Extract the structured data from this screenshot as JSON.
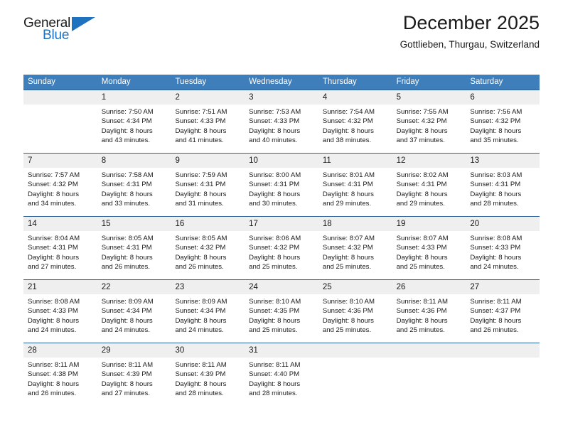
{
  "brand": {
    "name_part1": "General",
    "name_part2": "Blue",
    "flag_icon": "triangle-flag-icon"
  },
  "header": {
    "title": "December 2025",
    "subtitle": "Gottlieben, Thurgau, Switzerland"
  },
  "colors": {
    "header_blue": "#3d7ebb",
    "separator_blue": "#2b6198",
    "brand_blue": "#1f72bd",
    "day_band_gray": "#efefef",
    "text": "#1a1a1a"
  },
  "weekdays": [
    "Sunday",
    "Monday",
    "Tuesday",
    "Wednesday",
    "Thursday",
    "Friday",
    "Saturday"
  ],
  "weeks": [
    [
      {
        "day": "",
        "lines": []
      },
      {
        "day": "1",
        "lines": [
          "Sunrise: 7:50 AM",
          "Sunset: 4:34 PM",
          "Daylight: 8 hours",
          "and 43 minutes."
        ]
      },
      {
        "day": "2",
        "lines": [
          "Sunrise: 7:51 AM",
          "Sunset: 4:33 PM",
          "Daylight: 8 hours",
          "and 41 minutes."
        ]
      },
      {
        "day": "3",
        "lines": [
          "Sunrise: 7:53 AM",
          "Sunset: 4:33 PM",
          "Daylight: 8 hours",
          "and 40 minutes."
        ]
      },
      {
        "day": "4",
        "lines": [
          "Sunrise: 7:54 AM",
          "Sunset: 4:32 PM",
          "Daylight: 8 hours",
          "and 38 minutes."
        ]
      },
      {
        "day": "5",
        "lines": [
          "Sunrise: 7:55 AM",
          "Sunset: 4:32 PM",
          "Daylight: 8 hours",
          "and 37 minutes."
        ]
      },
      {
        "day": "6",
        "lines": [
          "Sunrise: 7:56 AM",
          "Sunset: 4:32 PM",
          "Daylight: 8 hours",
          "and 35 minutes."
        ]
      }
    ],
    [
      {
        "day": "7",
        "lines": [
          "Sunrise: 7:57 AM",
          "Sunset: 4:32 PM",
          "Daylight: 8 hours",
          "and 34 minutes."
        ]
      },
      {
        "day": "8",
        "lines": [
          "Sunrise: 7:58 AM",
          "Sunset: 4:31 PM",
          "Daylight: 8 hours",
          "and 33 minutes."
        ]
      },
      {
        "day": "9",
        "lines": [
          "Sunrise: 7:59 AM",
          "Sunset: 4:31 PM",
          "Daylight: 8 hours",
          "and 31 minutes."
        ]
      },
      {
        "day": "10",
        "lines": [
          "Sunrise: 8:00 AM",
          "Sunset: 4:31 PM",
          "Daylight: 8 hours",
          "and 30 minutes."
        ]
      },
      {
        "day": "11",
        "lines": [
          "Sunrise: 8:01 AM",
          "Sunset: 4:31 PM",
          "Daylight: 8 hours",
          "and 29 minutes."
        ]
      },
      {
        "day": "12",
        "lines": [
          "Sunrise: 8:02 AM",
          "Sunset: 4:31 PM",
          "Daylight: 8 hours",
          "and 29 minutes."
        ]
      },
      {
        "day": "13",
        "lines": [
          "Sunrise: 8:03 AM",
          "Sunset: 4:31 PM",
          "Daylight: 8 hours",
          "and 28 minutes."
        ]
      }
    ],
    [
      {
        "day": "14",
        "lines": [
          "Sunrise: 8:04 AM",
          "Sunset: 4:31 PM",
          "Daylight: 8 hours",
          "and 27 minutes."
        ]
      },
      {
        "day": "15",
        "lines": [
          "Sunrise: 8:05 AM",
          "Sunset: 4:31 PM",
          "Daylight: 8 hours",
          "and 26 minutes."
        ]
      },
      {
        "day": "16",
        "lines": [
          "Sunrise: 8:05 AM",
          "Sunset: 4:32 PM",
          "Daylight: 8 hours",
          "and 26 minutes."
        ]
      },
      {
        "day": "17",
        "lines": [
          "Sunrise: 8:06 AM",
          "Sunset: 4:32 PM",
          "Daylight: 8 hours",
          "and 25 minutes."
        ]
      },
      {
        "day": "18",
        "lines": [
          "Sunrise: 8:07 AM",
          "Sunset: 4:32 PM",
          "Daylight: 8 hours",
          "and 25 minutes."
        ]
      },
      {
        "day": "19",
        "lines": [
          "Sunrise: 8:07 AM",
          "Sunset: 4:33 PM",
          "Daylight: 8 hours",
          "and 25 minutes."
        ]
      },
      {
        "day": "20",
        "lines": [
          "Sunrise: 8:08 AM",
          "Sunset: 4:33 PM",
          "Daylight: 8 hours",
          "and 24 minutes."
        ]
      }
    ],
    [
      {
        "day": "21",
        "lines": [
          "Sunrise: 8:08 AM",
          "Sunset: 4:33 PM",
          "Daylight: 8 hours",
          "and 24 minutes."
        ]
      },
      {
        "day": "22",
        "lines": [
          "Sunrise: 8:09 AM",
          "Sunset: 4:34 PM",
          "Daylight: 8 hours",
          "and 24 minutes."
        ]
      },
      {
        "day": "23",
        "lines": [
          "Sunrise: 8:09 AM",
          "Sunset: 4:34 PM",
          "Daylight: 8 hours",
          "and 24 minutes."
        ]
      },
      {
        "day": "24",
        "lines": [
          "Sunrise: 8:10 AM",
          "Sunset: 4:35 PM",
          "Daylight: 8 hours",
          "and 25 minutes."
        ]
      },
      {
        "day": "25",
        "lines": [
          "Sunrise: 8:10 AM",
          "Sunset: 4:36 PM",
          "Daylight: 8 hours",
          "and 25 minutes."
        ]
      },
      {
        "day": "26",
        "lines": [
          "Sunrise: 8:11 AM",
          "Sunset: 4:36 PM",
          "Daylight: 8 hours",
          "and 25 minutes."
        ]
      },
      {
        "day": "27",
        "lines": [
          "Sunrise: 8:11 AM",
          "Sunset: 4:37 PM",
          "Daylight: 8 hours",
          "and 26 minutes."
        ]
      }
    ],
    [
      {
        "day": "28",
        "lines": [
          "Sunrise: 8:11 AM",
          "Sunset: 4:38 PM",
          "Daylight: 8 hours",
          "and 26 minutes."
        ]
      },
      {
        "day": "29",
        "lines": [
          "Sunrise: 8:11 AM",
          "Sunset: 4:39 PM",
          "Daylight: 8 hours",
          "and 27 minutes."
        ]
      },
      {
        "day": "30",
        "lines": [
          "Sunrise: 8:11 AM",
          "Sunset: 4:39 PM",
          "Daylight: 8 hours",
          "and 28 minutes."
        ]
      },
      {
        "day": "31",
        "lines": [
          "Sunrise: 8:11 AM",
          "Sunset: 4:40 PM",
          "Daylight: 8 hours",
          "and 28 minutes."
        ]
      },
      {
        "day": "",
        "lines": []
      },
      {
        "day": "",
        "lines": []
      },
      {
        "day": "",
        "lines": []
      }
    ]
  ]
}
